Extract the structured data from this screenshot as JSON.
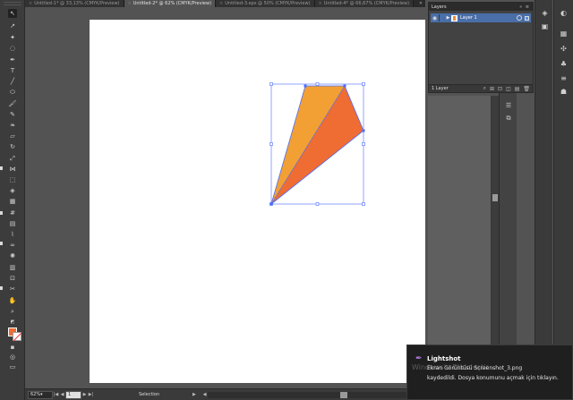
{
  "tabs": [
    {
      "label": "Untitled-1* @ 33,13% (CMYK/Preview)",
      "active": false
    },
    {
      "label": "Untitled-2* @ 62% (CMYK/Preview)",
      "active": true
    },
    {
      "label": "Untitled-3.eps @ 50% (CMYK/Preview)",
      "active": false
    },
    {
      "label": "Untitled-4* @ 66,67% (CMYK/Preview)",
      "active": false
    }
  ],
  "tab_overflow": "»",
  "layers_panel": {
    "title": "Layers",
    "header_controls": "« ≡",
    "layer": {
      "name": "Layer 1",
      "eye": "◉",
      "caret": "▶"
    },
    "count": "1 Layer",
    "footer_icons": [
      "⌕",
      "⊞",
      "⊡",
      "◫",
      "▤",
      "🗑"
    ]
  },
  "status": {
    "zoom": "62%",
    "zoom_caret": "▾",
    "nav_first": "|◀",
    "nav_prev": "◀",
    "page": "1",
    "nav_next": "▶",
    "nav_last": "▶|",
    "tool_text": "Selection",
    "tool_caret": "▶",
    "scroll_left": "◀",
    "scroll_right": "▶"
  },
  "toast": {
    "app_name": "Lightshot",
    "icon": "✒",
    "line1": "Ekran Görüntüsü Screenshot_3.png",
    "line2": "kaydedildi. Dosya konumunu açmak için tıklayın.",
    "ghost_text": "Windows'u Etkinleştir"
  },
  "artwork": {
    "left_face_color": "#f2a034",
    "right_face_color": "#ef6c33",
    "selection_color": "#4a6cff"
  },
  "swatches": {
    "fill": "#ef6c33",
    "stroke": "#ffffff"
  }
}
